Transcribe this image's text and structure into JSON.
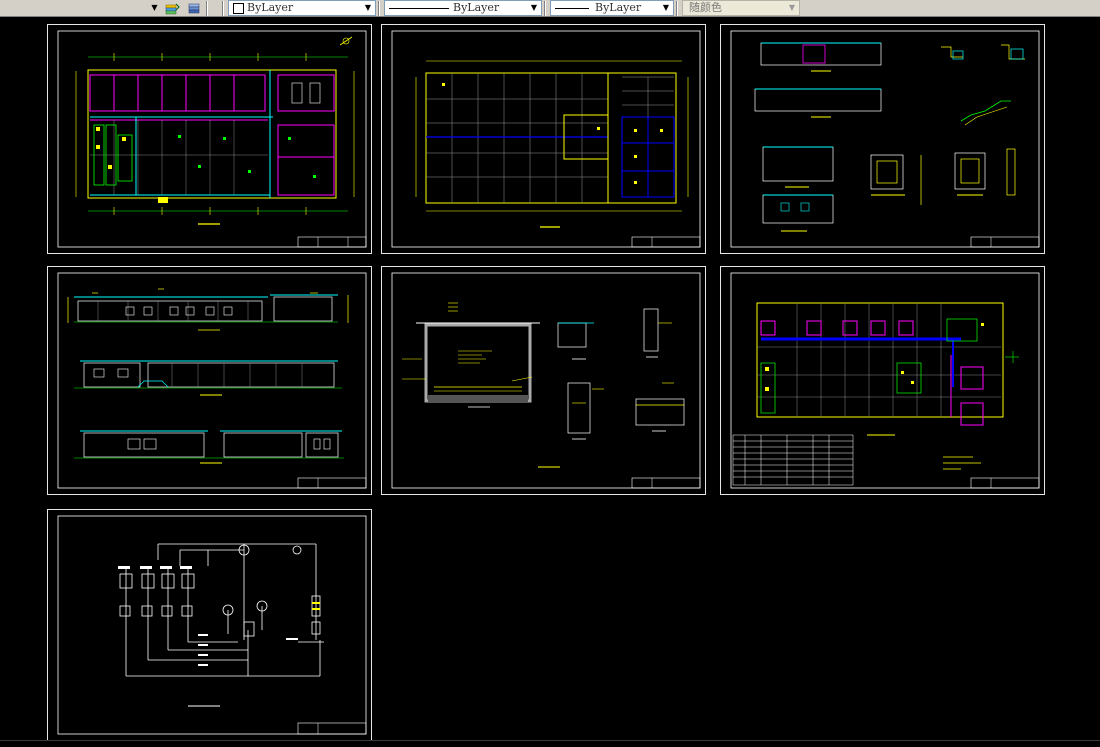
{
  "toolbar": {
    "layer_buttons": [
      "layer-previous-icon",
      "layer-states-icon"
    ],
    "color": {
      "value": "ByLayer",
      "icon": "color-swatch-icon"
    },
    "linetype": {
      "value": "ByLayer"
    },
    "lineweight": {
      "value": "ByLayer"
    },
    "plotstyle": {
      "value": "随颜色"
    }
  },
  "colors": {
    "background": "#000000",
    "sheet_border": "#e6e6e6",
    "yellow": "#ffff00",
    "magenta": "#ff00ff",
    "green": "#00ff00",
    "cyan": "#00ffff",
    "blue": "#0000ff",
    "white": "#ffffff",
    "red": "#ff3333"
  },
  "sheets": [
    {
      "id": "sheet-1",
      "content": "floor-plan"
    },
    {
      "id": "sheet-2",
      "content": "roof-grid-plan"
    },
    {
      "id": "sheet-3",
      "content": "details-and-sections"
    },
    {
      "id": "sheet-4",
      "content": "elevations"
    },
    {
      "id": "sheet-5",
      "content": "pool-section-details"
    },
    {
      "id": "sheet-6",
      "content": "equipment-plan-with-table"
    },
    {
      "id": "sheet-7",
      "content": "process-schematic"
    }
  ]
}
